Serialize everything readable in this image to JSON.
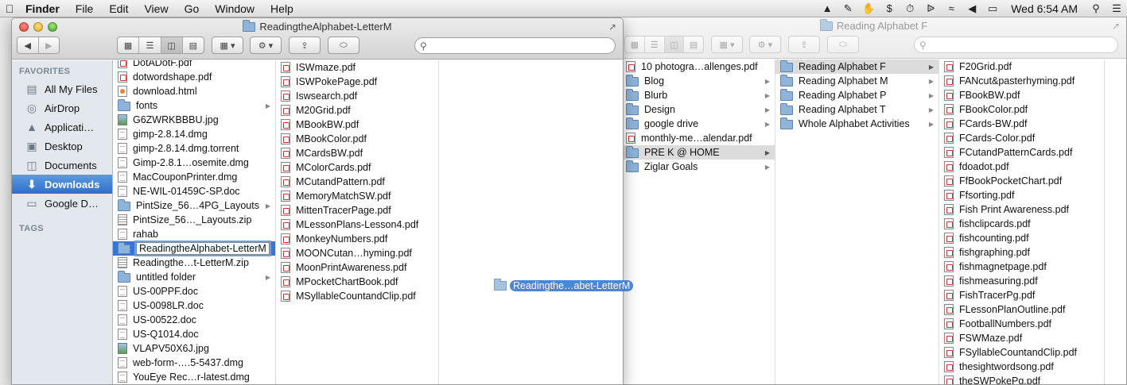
{
  "menubar": {
    "apple_icon": "apple-icon",
    "app_name": "Finder",
    "menus": [
      "File",
      "Edit",
      "View",
      "Go",
      "Window",
      "Help"
    ],
    "status_icons": [
      "google-drive-icon",
      "evernote-icon",
      "hand-icon",
      "dollar-icon",
      "time-machine-icon",
      "bluetooth-icon",
      "wifi-icon",
      "volume-icon",
      "battery-icon"
    ],
    "clock": "Wed 6:54 AM",
    "spotlight_icon": "search-icon",
    "menu_list_icon": "list-icon"
  },
  "front_window": {
    "title": "ReadingtheAlphabet-LetterM",
    "search_placeholder": "",
    "sidebar": {
      "favorites_heading": "FAVORITES",
      "tags_heading": "TAGS",
      "items": [
        {
          "label": "All My Files",
          "icon": "all-files-icon"
        },
        {
          "label": "AirDrop",
          "icon": "airdrop-icon"
        },
        {
          "label": "Applicati…",
          "icon": "applications-icon"
        },
        {
          "label": "Desktop",
          "icon": "desktop-icon"
        },
        {
          "label": "Documents",
          "icon": "documents-icon"
        },
        {
          "label": "Downloads",
          "icon": "downloads-icon",
          "selected": true
        },
        {
          "label": "Google D…",
          "icon": "folder-icon"
        }
      ]
    },
    "col1": [
      {
        "name": "DotADotF.pdf",
        "type": "pdf"
      },
      {
        "name": "dotwordshape.pdf",
        "type": "pdf"
      },
      {
        "name": "download.html",
        "type": "html"
      },
      {
        "name": "fonts",
        "type": "folder",
        "arrow": true
      },
      {
        "name": "G6ZWRKBBBU.jpg",
        "type": "img"
      },
      {
        "name": "gimp-2.8.14.dmg",
        "type": "doc"
      },
      {
        "name": "gimp-2.8.14.dmg.torrent",
        "type": "doc"
      },
      {
        "name": "Gimp-2.8.1…osemite.dmg",
        "type": "doc"
      },
      {
        "name": "MacCouponPrinter.dmg",
        "type": "doc"
      },
      {
        "name": "NE-WIL-01459C-SP.doc",
        "type": "doc"
      },
      {
        "name": "PintSize_56…4PG_Layouts",
        "type": "folder",
        "arrow": true
      },
      {
        "name": "PintSize_56…_Layouts.zip",
        "type": "zip"
      },
      {
        "name": "rahab",
        "type": "doc"
      },
      {
        "name": "ReadingtheAlphabet-LetterM",
        "type": "folder",
        "renaming": true
      },
      {
        "name": "Readingthe…t-LetterM.zip",
        "type": "zip"
      },
      {
        "name": "untitled folder",
        "type": "folder",
        "arrow": true
      },
      {
        "name": "US-00PPF.doc",
        "type": "doc"
      },
      {
        "name": "US-0098LR.doc",
        "type": "doc"
      },
      {
        "name": "US-00522.doc",
        "type": "doc"
      },
      {
        "name": "US-Q1014.doc",
        "type": "doc"
      },
      {
        "name": "VLAPV50X6J.jpg",
        "type": "img"
      },
      {
        "name": "web-form-….5-5437.dmg",
        "type": "doc"
      },
      {
        "name": "YouEye Rec…r-latest.dmg",
        "type": "doc"
      }
    ],
    "col2": [
      {
        "name": "ISWmaze.pdf",
        "type": "pdf"
      },
      {
        "name": "ISWPokePage.pdf",
        "type": "pdf"
      },
      {
        "name": "Iswsearch.pdf",
        "type": "pdf"
      },
      {
        "name": "M20Grid.pdf",
        "type": "pdf"
      },
      {
        "name": "MBookBW.pdf",
        "type": "pdf"
      },
      {
        "name": "MBookColor.pdf",
        "type": "pdf"
      },
      {
        "name": "MCardsBW.pdf",
        "type": "pdf"
      },
      {
        "name": "MColorCards.pdf",
        "type": "pdf"
      },
      {
        "name": "MCutandPattern.pdf",
        "type": "pdf"
      },
      {
        "name": "MemoryMatchSW.pdf",
        "type": "pdf"
      },
      {
        "name": "MittenTracerPage.pdf",
        "type": "pdf"
      },
      {
        "name": "MLessonPlans-Lesson4.pdf",
        "type": "pdf"
      },
      {
        "name": "MonkeyNumbers.pdf",
        "type": "pdf"
      },
      {
        "name": "MOONCutan…hyming.pdf",
        "type": "pdf"
      },
      {
        "name": "MoonPrintAwareness.pdf",
        "type": "pdf"
      },
      {
        "name": "MPocketChartBook.pdf",
        "type": "pdf"
      },
      {
        "name": "MSyllableCountandClip.pdf",
        "type": "pdf"
      }
    ],
    "drag_ghost_label": "Readingthe…abet-LetterM"
  },
  "back_window": {
    "title": "Reading Alphabet F",
    "col1": [
      {
        "name": "10 photogra…allenges.pdf",
        "type": "pdf"
      },
      {
        "name": "Blog",
        "type": "folder",
        "arrow": true
      },
      {
        "name": "Blurb",
        "type": "folder",
        "arrow": true
      },
      {
        "name": "Design",
        "type": "folder",
        "arrow": true
      },
      {
        "name": "google drive",
        "type": "folder",
        "arrow": true
      },
      {
        "name": "monthly-me…alendar.pdf",
        "type": "pdf"
      },
      {
        "name": "PRE K @ HOME",
        "type": "folder",
        "arrow": true,
        "gray_selected": true
      },
      {
        "name": "Ziglar Goals",
        "type": "folder",
        "arrow": true
      }
    ],
    "col2": [
      {
        "name": "Reading Alphabet F",
        "type": "folder",
        "arrow": true,
        "gray_selected": true
      },
      {
        "name": "Reading Alphabet M",
        "type": "folder",
        "arrow": true
      },
      {
        "name": "Reading Alphabet P",
        "type": "folder",
        "arrow": true
      },
      {
        "name": "Reading Alphabet T",
        "type": "folder",
        "arrow": true
      },
      {
        "name": "Whole Alphabet Activities",
        "type": "folder",
        "arrow": true
      }
    ],
    "col3": [
      {
        "name": "F20Grid.pdf",
        "type": "pdf"
      },
      {
        "name": "FANcut&pasterhyming.pdf",
        "type": "pdf"
      },
      {
        "name": "FBookBW.pdf",
        "type": "pdf"
      },
      {
        "name": "FBookColor.pdf",
        "type": "pdf"
      },
      {
        "name": "FCards-BW.pdf",
        "type": "pdf"
      },
      {
        "name": "FCards-Color.pdf",
        "type": "pdf"
      },
      {
        "name": "FCutandPatternCards.pdf",
        "type": "pdf"
      },
      {
        "name": "fdoadot.pdf",
        "type": "pdf"
      },
      {
        "name": "FfBookPocketChart.pdf",
        "type": "pdf"
      },
      {
        "name": "Ffsorting.pdf",
        "type": "pdf"
      },
      {
        "name": "Fish Print Awareness.pdf",
        "type": "pdf"
      },
      {
        "name": "fishclipcards.pdf",
        "type": "pdf"
      },
      {
        "name": "fishcounting.pdf",
        "type": "pdf"
      },
      {
        "name": "fishgraphing.pdf",
        "type": "pdf"
      },
      {
        "name": "fishmagnetpage.pdf",
        "type": "pdf"
      },
      {
        "name": "fishmeasuring.pdf",
        "type": "pdf"
      },
      {
        "name": "FishTracerPg.pdf",
        "type": "pdf"
      },
      {
        "name": "FLessonPlanOutline.pdf",
        "type": "pdf"
      },
      {
        "name": "FootballNumbers.pdf",
        "type": "pdf"
      },
      {
        "name": "FSWMaze.pdf",
        "type": "pdf"
      },
      {
        "name": "FSyllableCountandClip.pdf",
        "type": "pdf"
      },
      {
        "name": "thesightwordsong.pdf",
        "type": "pdf"
      },
      {
        "name": "theSWPokePg.pdf",
        "type": "pdf"
      }
    ]
  }
}
